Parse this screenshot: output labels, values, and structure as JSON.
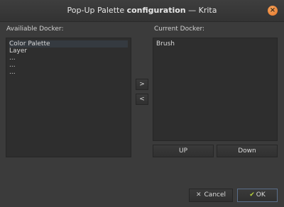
{
  "window": {
    "title_prefix": "Pop-Up Palette ",
    "title_bold": "configuration",
    "title_suffix": " — Krita",
    "close_icon": "×"
  },
  "left_panel": {
    "label": "Availiable Docker:",
    "items": [
      "Color Palette",
      "Layer",
      "...",
      "...",
      "..."
    ]
  },
  "right_panel": {
    "label": "Current Docker:",
    "items": [
      "Brush"
    ]
  },
  "transfer": {
    "add_label": ">",
    "remove_label": "<"
  },
  "order": {
    "up_label": "UP",
    "down_label": "Down"
  },
  "footer": {
    "cancel_icon": "✕",
    "cancel_label": "Cancel",
    "ok_icon": "✔",
    "ok_label": "OK"
  }
}
